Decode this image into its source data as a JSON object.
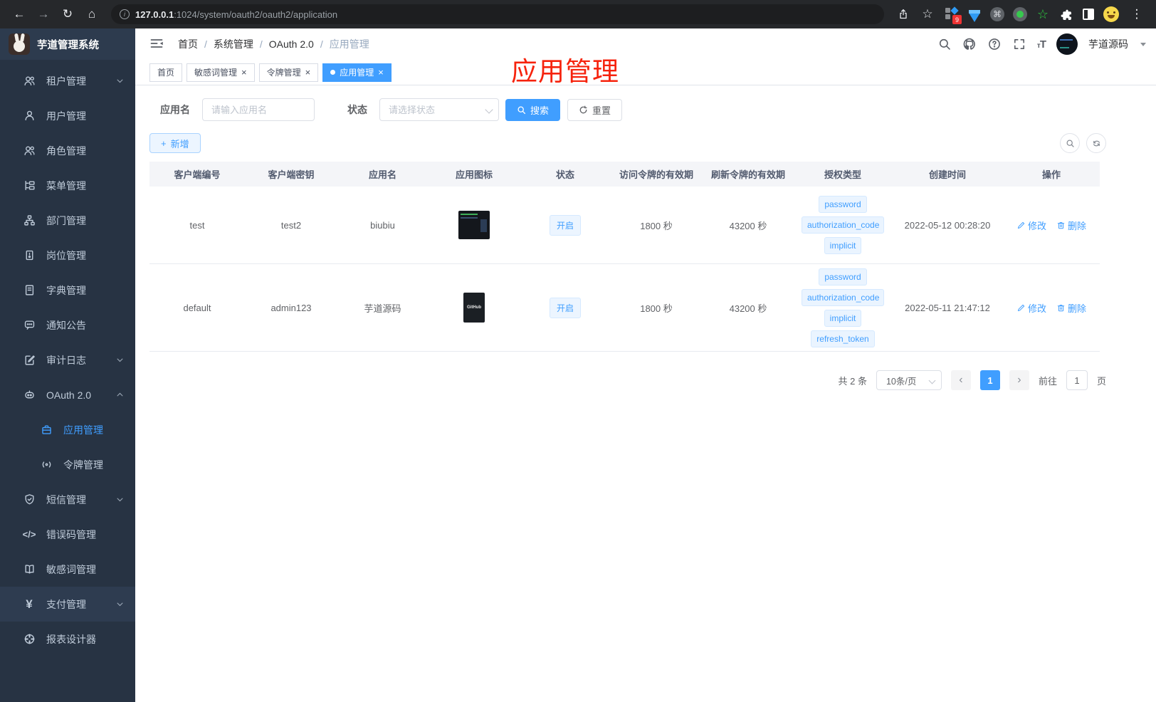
{
  "browser": {
    "url_host": "127.0.0.1",
    "url_rest": ":1024/system/oauth2/oauth2/application",
    "ext_badge": "9"
  },
  "sidebar": {
    "title": "芋道管理系统",
    "items": [
      {
        "label": "租户管理",
        "icon": "users-icon",
        "arrow": "down"
      },
      {
        "label": "用户管理",
        "icon": "user-icon"
      },
      {
        "label": "角色管理",
        "icon": "roles-icon"
      },
      {
        "label": "菜单管理",
        "icon": "menu-tree-icon"
      },
      {
        "label": "部门管理",
        "icon": "org-icon"
      },
      {
        "label": "岗位管理",
        "icon": "post-icon"
      },
      {
        "label": "字典管理",
        "icon": "dict-icon"
      },
      {
        "label": "通知公告",
        "icon": "notice-icon"
      },
      {
        "label": "审计日志",
        "icon": "log-icon",
        "arrow": "down"
      },
      {
        "label": "OAuth 2.0",
        "icon": "robot-icon",
        "arrow": "up",
        "children": [
          {
            "label": "应用管理",
            "icon": "briefcase-icon",
            "active": true
          },
          {
            "label": "令牌管理",
            "icon": "token-icon"
          }
        ]
      },
      {
        "label": "短信管理",
        "icon": "shield-icon",
        "arrow": "down"
      },
      {
        "label": "错误码管理",
        "icon": "code-icon"
      },
      {
        "label": "敏感词管理",
        "icon": "open-book-icon"
      },
      {
        "label": "支付管理",
        "icon": "yen-icon",
        "arrow": "down"
      },
      {
        "label": "报表设计器",
        "icon": "designer-icon"
      }
    ],
    "yen_glyph": "¥",
    "code_glyph": "</>"
  },
  "header": {
    "breadcrumb": [
      "首页",
      "系统管理",
      "OAuth 2.0",
      "应用管理"
    ],
    "user_name": "芋道源码"
  },
  "tabs": [
    {
      "label": "首页"
    },
    {
      "label": "敏感词管理",
      "close": "×"
    },
    {
      "label": "令牌管理",
      "close": "×"
    },
    {
      "label": "应用管理",
      "close": "×",
      "active": true
    }
  ],
  "annotation": "应用管理",
  "filters": {
    "app_name_label": "应用名",
    "app_name_placeholder": "请输入应用名",
    "status_label": "状态",
    "status_placeholder": "请选择状态",
    "search_label": "搜索",
    "reset_label": "重置"
  },
  "toolbar": {
    "add_label": "新增",
    "plus": "+"
  },
  "table": {
    "columns": [
      "客户端编号",
      "客户端密钥",
      "应用名",
      "应用图标",
      "状态",
      "访问令牌的有效期",
      "刷新令牌的有效期",
      "授权类型",
      "创建时间",
      "操作"
    ],
    "rows": [
      {
        "client_id": "test",
        "secret": "test2",
        "name": "biubiu",
        "icon": "screenshot-thumbnail",
        "status": "开启",
        "access_validity": "1800 秒",
        "refresh_validity": "43200 秒",
        "grant_types": [
          "password",
          "authorization_code",
          "implicit"
        ],
        "create_time": "2022-05-12 00:28:20",
        "edit_label": "修改",
        "delete_label": "删除"
      },
      {
        "client_id": "default",
        "secret": "admin123",
        "name": "芋道源码",
        "icon": "github-thumbnail",
        "icon_text": "GitHub",
        "status": "开启",
        "access_validity": "1800 秒",
        "refresh_validity": "43200 秒",
        "grant_types": [
          "password",
          "authorization_code",
          "implicit",
          "refresh_token"
        ],
        "create_time": "2022-05-11 21:47:12",
        "edit_label": "修改",
        "delete_label": "删除"
      }
    ]
  },
  "pagination": {
    "total": "共 2 条",
    "page_size": "10条/页",
    "prev": "‹",
    "next": "›",
    "current_page": "1",
    "goto_label": "前往",
    "goto_value": "1",
    "page_unit": "页"
  },
  "colors": {
    "accent": "#409eff",
    "annotation_red": "#f6230d",
    "sidebar_bg": "#273343"
  }
}
